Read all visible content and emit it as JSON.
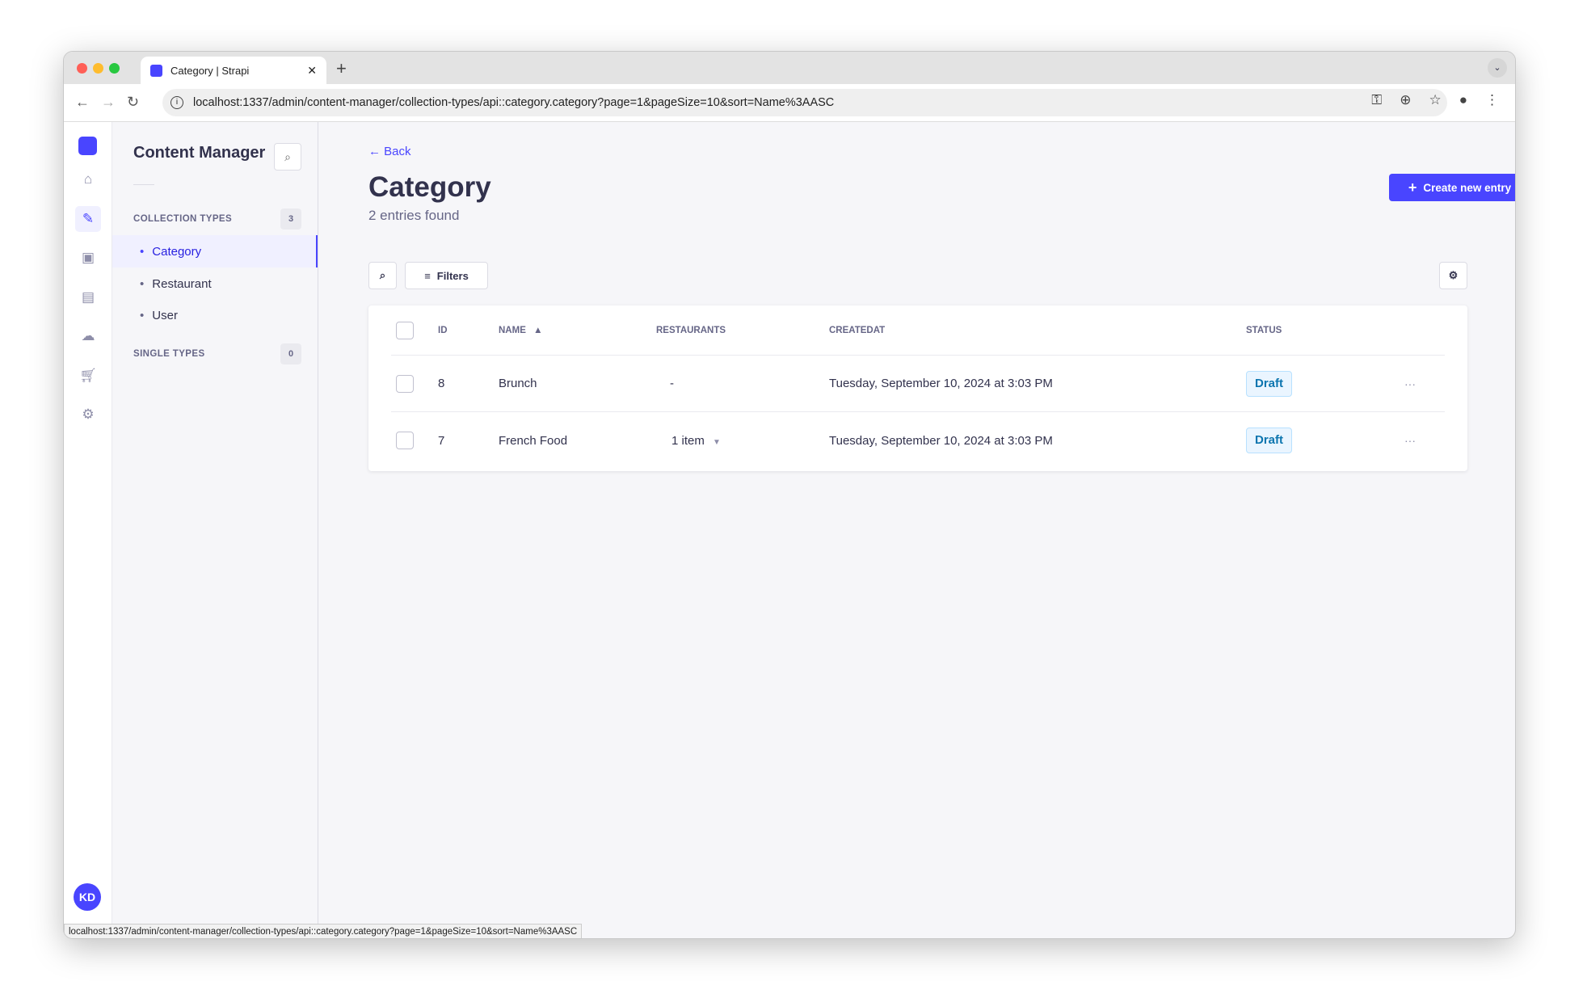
{
  "browser": {
    "tab_title": "Category | Strapi",
    "url": "localhost:1337/admin/content-manager/collection-types/api::category.category?page=1&pageSize=10&sort=Name%3AASC",
    "status_url": "localhost:1337/admin/content-manager/collection-types/api::category.category?page=1&pageSize=10&sort=Name%3AASC"
  },
  "rail": {
    "avatar": "KD",
    "icons": [
      "home-icon",
      "content-manager-feather-icon",
      "media-library-icon",
      "content-type-builder-icon",
      "cloud-icon",
      "marketplace-cart-icon",
      "settings-gear-icon"
    ]
  },
  "sidebar": {
    "title": "Content Manager",
    "collection_label": "COLLECTION TYPES",
    "collection_count": "3",
    "collection_items": [
      {
        "label": "Category",
        "active": true
      },
      {
        "label": "Restaurant"
      },
      {
        "label": "User"
      }
    ],
    "single_label": "SINGLE TYPES",
    "single_count": "0"
  },
  "main": {
    "back": "Back",
    "title": "Category",
    "subtitle": "2 entries found",
    "create_label": "Create new entry",
    "filters_label": "Filters"
  },
  "table": {
    "headers": [
      "ID",
      "NAME",
      "RESTAURANTS",
      "CREATEDAT",
      "STATUS"
    ],
    "sort": {
      "column": "NAME",
      "direction": "asc"
    },
    "rows": [
      {
        "id": "8",
        "name": "Brunch",
        "restaurants": "-",
        "created": "Tuesday, September 10, 2024 at 3:03 PM",
        "status": "Draft"
      },
      {
        "id": "7",
        "name": "French Food",
        "restaurants": "1 item",
        "created": "Tuesday, September 10, 2024 at 3:03 PM",
        "status": "Draft"
      }
    ]
  },
  "colors": {
    "primary": "#4945ff",
    "draft_badge": "#0c75af"
  }
}
